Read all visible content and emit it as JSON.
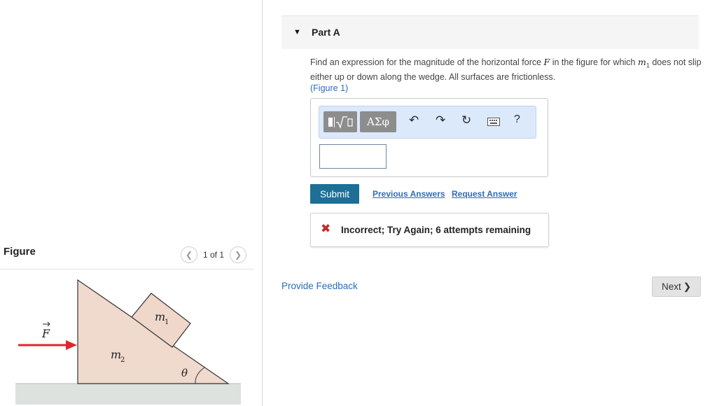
{
  "figure_panel": {
    "title": "Figure",
    "counter": "1 of 1",
    "prev_icon": "chevron-left-icon",
    "next_icon": "chevron-right-icon",
    "labels": {
      "force": "F",
      "m1": "m",
      "m1_sub": "1",
      "m2": "m",
      "m2_sub": "2",
      "angle": "θ"
    },
    "colors": {
      "wedge": "#f0d9cd",
      "block": "#efd7ca",
      "arrow": "#e0262d",
      "ground": "#d8ddd9"
    }
  },
  "part": {
    "caret_icon": "caret-down-icon",
    "label": "Part A",
    "question_a": "Find an expression for the magnitude of the horizontal force ",
    "question_F": "F",
    "question_b": " in the figure for which ",
    "question_m": "m",
    "question_sub": "1",
    "question_c": " does not slip either up or down along the wedge. All surfaces are frictionless.",
    "figure_link": "(Figure 1)"
  },
  "toolbar": {
    "templates_icon": "templates-sqrt-icon",
    "symbols_label": "ΑΣφ",
    "undo_icon": "undo-icon",
    "redo_icon": "redo-icon",
    "reset_icon": "reset-icon",
    "keyboard_icon": "keyboard-icon",
    "help_label": "?"
  },
  "answer": {
    "value": ""
  },
  "buttons": {
    "submit": "Submit",
    "previous_answers": "Previous Answers",
    "request_answer": "Request Answer",
    "next": "Next"
  },
  "feedback": {
    "status_icon": "x-mark-icon",
    "message": "Incorrect; Try Again; 6 attempts remaining"
  },
  "footer": {
    "provide_feedback": "Provide Feedback"
  },
  "colors": {
    "accent": "#1d6f96",
    "link": "#2a6ebb",
    "error": "#c8282e"
  }
}
